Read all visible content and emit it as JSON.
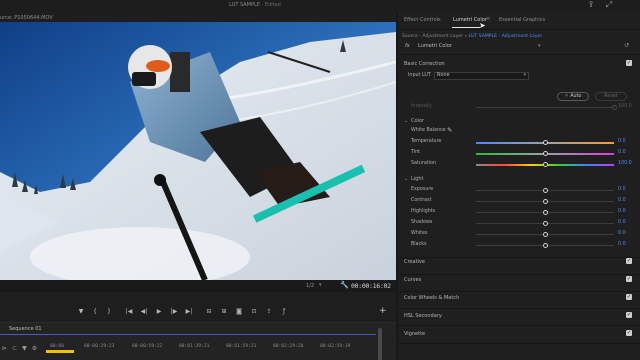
{
  "titlebar": {
    "title": "LUT SAMPLE",
    "edited": " - Edited",
    "icons": [
      "share-icon",
      "fullscreen-icon"
    ]
  },
  "source_monitor": {
    "label": "urce: P1050644.MOV",
    "fraction": "1/2",
    "timecode": "00:00:16:02"
  },
  "transport": {
    "buttons": [
      "marker",
      "in",
      "out",
      "go-to-in",
      "step-back",
      "play",
      "step-forward",
      "go-to-out",
      "insert",
      "overwrite",
      "export-frame",
      "button-editor",
      "settings",
      "fx"
    ]
  },
  "sequence": {
    "tab": "Sequence 01",
    "ruler": [
      "00:00",
      "00:00:29:23",
      "00:00:59:22",
      "00:01:29:21",
      "00:01:59:21",
      "00:02:29:20",
      "00:02:59:19"
    ]
  },
  "panel": {
    "tabs": [
      {
        "label": "Effect Controls",
        "active": false
      },
      {
        "label": "Lumetri Color",
        "active": true
      },
      {
        "label": "Essential Graphics",
        "active": false
      }
    ],
    "menu_glyph": "≡",
    "source": {
      "prefix": "Source - Adjustment Layer",
      "sep": " » ",
      "lut": "LUT SAMPLE - Adjustment Layer"
    },
    "effect": {
      "fx": "fx",
      "name": "Lumetri Color"
    },
    "basic_correction": {
      "title": "Basic Correction",
      "input_lut_label": "Input LUT",
      "input_lut_value": "None",
      "intensity_label": "Intensity",
      "intensity_value": "100.0",
      "intensity_fraction": 1.0,
      "auto": "Auto",
      "reset": "Reset",
      "color": {
        "title": "Color",
        "white_balance": "White Balance",
        "temperature": {
          "label": "Temperature",
          "value": "0.0",
          "fraction": 0.5
        },
        "tint": {
          "label": "Tint",
          "value": "0.0",
          "fraction": 0.5
        },
        "saturation": {
          "label": "Saturation",
          "value": "100.0",
          "fraction": 0.5
        }
      },
      "light": {
        "title": "Light",
        "rows": [
          {
            "label": "Exposure",
            "value": "0.0",
            "fraction": 0.5
          },
          {
            "label": "Contrast",
            "value": "0.0",
            "fraction": 0.5
          },
          {
            "label": "Highlights",
            "value": "0.0",
            "fraction": 0.5
          },
          {
            "label": "Shadows",
            "value": "0.0",
            "fraction": 0.5
          },
          {
            "label": "Whites",
            "value": "0.0",
            "fraction": 0.5
          },
          {
            "label": "Blacks",
            "value": "0.0",
            "fraction": 0.5
          }
        ]
      }
    },
    "sections": [
      "Creative",
      "Curves",
      "Color Wheels & Match",
      "HSL Secondary",
      "Vignette"
    ]
  }
}
